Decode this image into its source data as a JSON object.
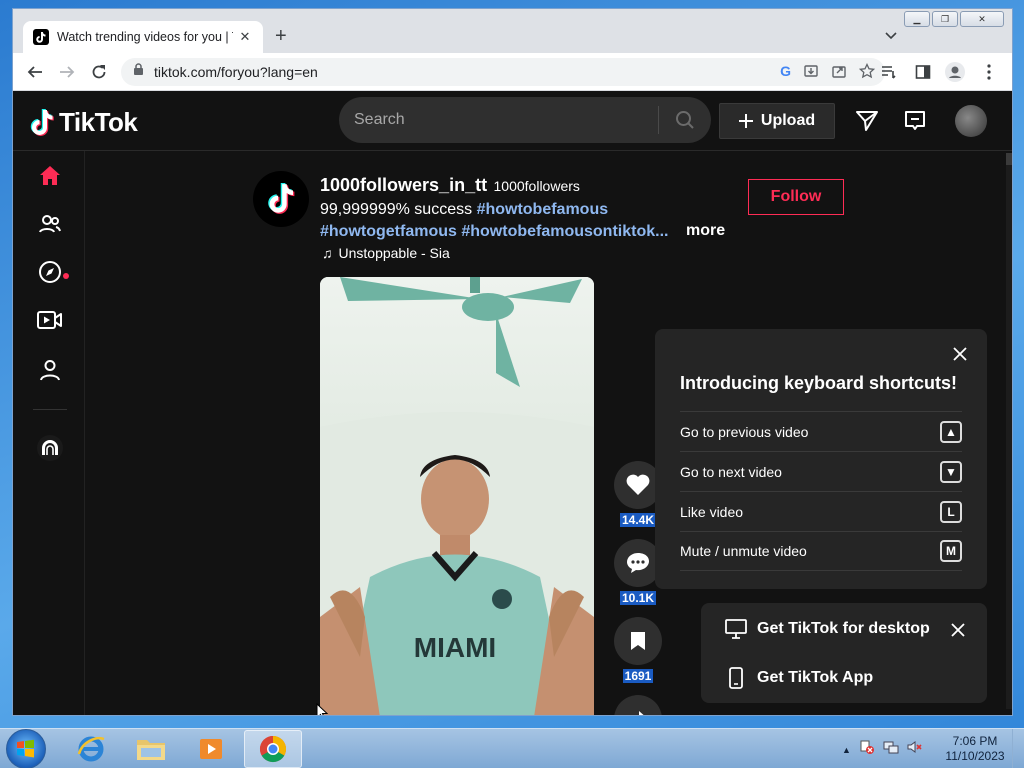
{
  "browser": {
    "tab_title": "Watch trending videos for you | T",
    "url": "tiktok.com/foryou?lang=en"
  },
  "header": {
    "logo_text": "TikTok",
    "search_placeholder": "Search",
    "upload_label": "Upload"
  },
  "sidebar": {
    "items": [
      "home-icon",
      "following-icon",
      "explore-icon",
      "live-icon",
      "profile-icon",
      "friends-icon"
    ],
    "accent": "#fe2c55"
  },
  "post": {
    "username": "1000followers_in_tt",
    "nickname": "1000followers",
    "caption": "99,999999% success",
    "tags": [
      "#howtobefamous",
      "#howtogetfamous",
      "#howtobefamousontiktok..."
    ],
    "more_label": "more",
    "music": "Unstoppable - Sia",
    "follow_label": "Follow",
    "jersey_text": "MIAMI"
  },
  "actions": {
    "likes": "14.4K",
    "comments": "10.1K",
    "saves": "1691"
  },
  "shortcuts": {
    "title": "Introducing keyboard shortcuts!",
    "rows": [
      {
        "label": "Go to previous video",
        "key": "▲"
      },
      {
        "label": "Go to next video",
        "key": "▼"
      },
      {
        "label": "Like video",
        "key": "L"
      },
      {
        "label": "Mute / unmute video",
        "key": "M"
      }
    ]
  },
  "app_panel": {
    "desktop_label": "Get TikTok for desktop",
    "app_label": "Get TikTok App"
  },
  "taskbar": {
    "time": "7:06 PM",
    "date": "11/10/2023"
  }
}
